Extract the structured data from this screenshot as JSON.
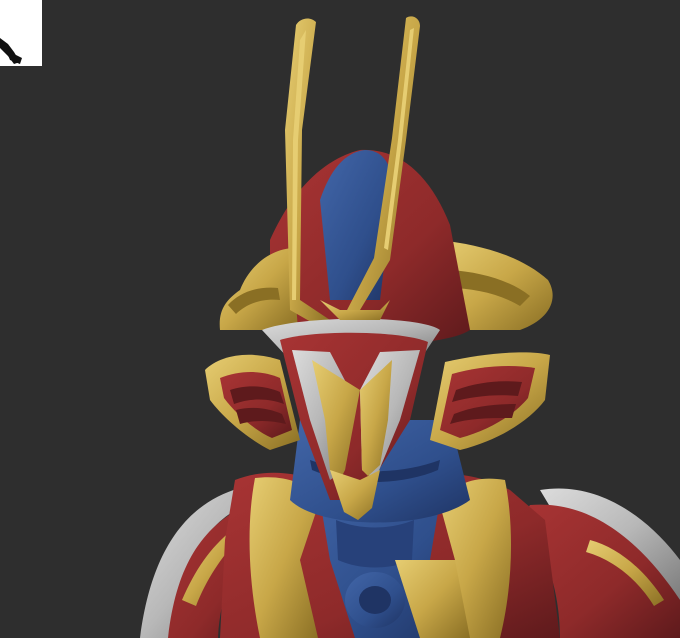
{
  "viewport": {
    "background": "#2e2e2e"
  },
  "corner_widget": {
    "icon": "arrow-pointer-icon",
    "background": "#ffffff"
  },
  "model": {
    "subject": "armored-helmet-bust",
    "colors": {
      "gold": "#c8a748",
      "gold_dark": "#8a6f24",
      "gold_light": "#e2c86a",
      "red": "#8e2a2a",
      "red_dark": "#5e1a1c",
      "blue": "#2f4f8c",
      "blue_dark": "#1f3464",
      "silver": "#b8b8b8",
      "silver_dark": "#7c7c7c"
    }
  }
}
